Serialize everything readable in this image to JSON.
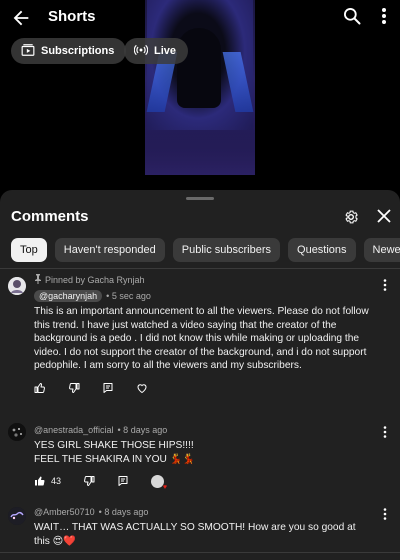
{
  "app": {
    "title": "Shorts"
  },
  "top_chips": {
    "subscriptions": "Subscriptions",
    "live": "Live"
  },
  "comments_sheet": {
    "title": "Comments",
    "filters": [
      "Top",
      "Haven't responded",
      "Public subscribers",
      "Questions",
      "Newest"
    ],
    "active_filter": "Top"
  },
  "comments": [
    {
      "pinned_label": "Pinned by Gacha Rynjah",
      "author": "@gacharynjah",
      "time": "• 5 sec ago",
      "text": "This is an important announcement to all the viewers. Please do not follow this trend. I have just watched a video saying that the creator of the background is a pedo . I did not know this while making or uploading the video.  I do not support the creator of the background, and i do not support pedophile.   I am sorry to all the viewers and my subscribers."
    },
    {
      "author": "@anestrada_official",
      "time": "• 8 days ago",
      "text_line1": "YES GIRL SHAKE THOSE HIPS!!!!",
      "text_line2": "FEEL THE SHAKIRA IN YOU 💃💃",
      "likes": "43"
    },
    {
      "author": "@Amber50710",
      "time": "• 8 days ago",
      "text": "WAIT… THAT WAS ACTUALLY SO SMOOTH! How are you so good at this 😍❤️"
    }
  ],
  "colors": {
    "background": "#000000",
    "sheet": "#212121",
    "chip": "#3a3a3a",
    "active_chip": "#f1f1f1",
    "secondary_text": "#aaaaaa"
  }
}
